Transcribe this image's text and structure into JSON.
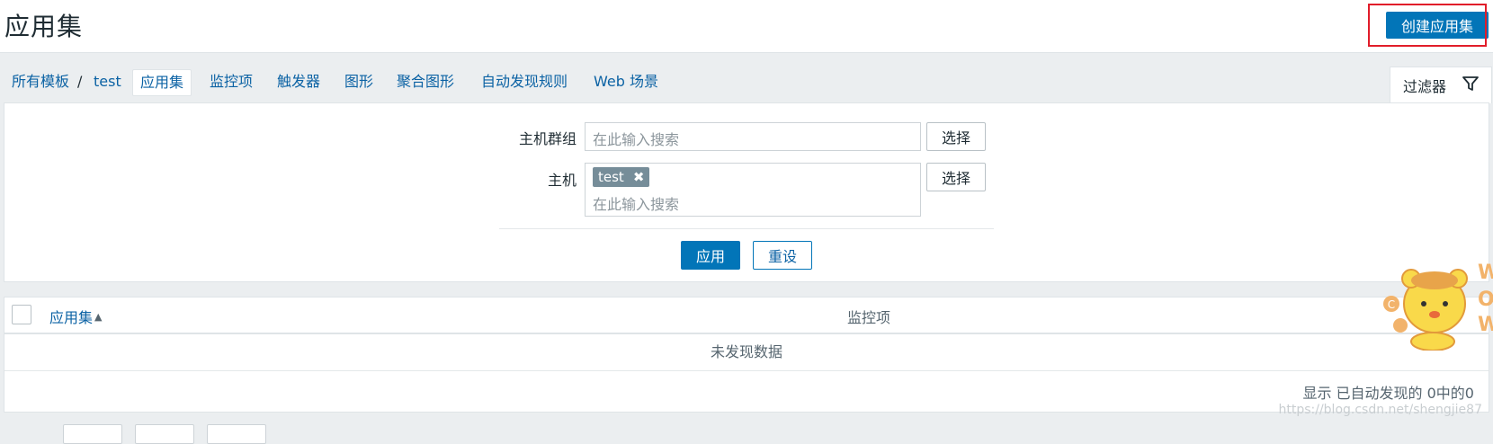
{
  "header": {
    "title": "应用集",
    "create_button": "创建应用集"
  },
  "breadcrumb": {
    "all_templates": "所有模板",
    "separator": "/",
    "template": "test"
  },
  "tabs": [
    {
      "label": "应用集",
      "active": true
    },
    {
      "label": "监控项"
    },
    {
      "label": "触发器"
    },
    {
      "label": "图形"
    },
    {
      "label": "聚合图形"
    },
    {
      "label": "自动发现规则"
    },
    {
      "label": "Web 场景"
    }
  ],
  "filter": {
    "tab_label": "过滤器",
    "host_group_label": "主机群组",
    "host_group_placeholder": "在此输入搜索",
    "host_label": "主机",
    "host_tag": "test",
    "host_placeholder": "在此输入搜索",
    "select_label": "选择",
    "apply_label": "应用",
    "reset_label": "重设"
  },
  "table": {
    "col_applications": "应用集",
    "col_items": "监控项",
    "no_data": "未发现数据",
    "summary": "显示 已自动发现的 0中的0"
  },
  "watermark": "https://blog.csdn.net/shengjie87",
  "colors": {
    "primary": "#0275b8",
    "link": "#0b62a4",
    "highlight": "#e11d2a"
  }
}
